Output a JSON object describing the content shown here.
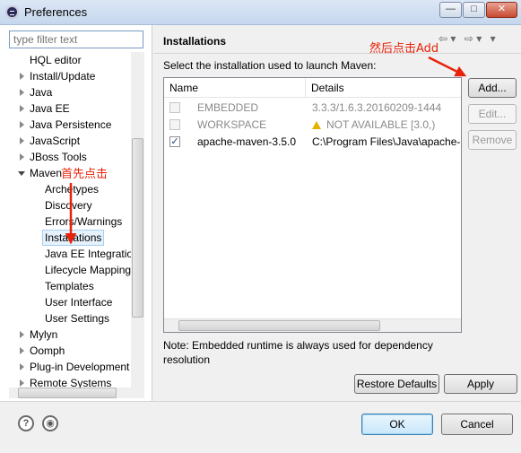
{
  "window": {
    "title": "Preferences",
    "controls": {
      "minimize": "—",
      "maximize": "□",
      "close": "✕"
    }
  },
  "sidebar": {
    "filter_placeholder": "type filter text",
    "items": [
      {
        "label": "HQL editor",
        "indent": 0,
        "toggle": "none"
      },
      {
        "label": "Install/Update",
        "indent": 0,
        "toggle": "collapsed"
      },
      {
        "label": "Java",
        "indent": 0,
        "toggle": "collapsed"
      },
      {
        "label": "Java EE",
        "indent": 0,
        "toggle": "collapsed"
      },
      {
        "label": "Java Persistence",
        "indent": 0,
        "toggle": "collapsed"
      },
      {
        "label": "JavaScript",
        "indent": 0,
        "toggle": "collapsed"
      },
      {
        "label": "JBoss Tools",
        "indent": 0,
        "toggle": "collapsed"
      },
      {
        "label": "Maven",
        "indent": 0,
        "toggle": "expanded"
      },
      {
        "label": "Archetypes",
        "indent": 1,
        "toggle": "none"
      },
      {
        "label": "Discovery",
        "indent": 1,
        "toggle": "none"
      },
      {
        "label": "Errors/Warnings",
        "indent": 1,
        "toggle": "none"
      },
      {
        "label": "Installations",
        "indent": 1,
        "toggle": "none",
        "selected": true
      },
      {
        "label": "Java EE Integration",
        "indent": 1,
        "toggle": "none"
      },
      {
        "label": "Lifecycle Mappings",
        "indent": 1,
        "toggle": "none"
      },
      {
        "label": "Templates",
        "indent": 1,
        "toggle": "none"
      },
      {
        "label": "User Interface",
        "indent": 1,
        "toggle": "none"
      },
      {
        "label": "User Settings",
        "indent": 1,
        "toggle": "none"
      },
      {
        "label": "Mylyn",
        "indent": 0,
        "toggle": "collapsed"
      },
      {
        "label": "Oomph",
        "indent": 0,
        "toggle": "collapsed"
      },
      {
        "label": "Plug-in Development",
        "indent": 0,
        "toggle": "collapsed"
      },
      {
        "label": "Remote Systems",
        "indent": 0,
        "toggle": "collapsed"
      }
    ]
  },
  "page": {
    "title": "Installations",
    "instruction": "Select the installation used to launch Maven:",
    "table": {
      "columns": [
        "Name",
        "Details"
      ],
      "rows": [
        {
          "checked": false,
          "disabled": true,
          "name": "EMBEDDED",
          "details": "3.3.3/1.6.3.20160209-1444",
          "warning": false
        },
        {
          "checked": false,
          "disabled": true,
          "name": "WORKSPACE",
          "details": "NOT AVAILABLE [3.0,)",
          "warning": true
        },
        {
          "checked": true,
          "disabled": false,
          "name": "apache-maven-3.5.0",
          "details": "C:\\Program Files\\Java\\apache-m",
          "warning": false
        }
      ]
    },
    "buttons": {
      "add": "Add...",
      "edit": "Edit...",
      "remove": "Remove",
      "restore_defaults": "Restore Defaults",
      "apply": "Apply"
    },
    "note": "Note: Embedded runtime is always used for dependency resolution"
  },
  "footer": {
    "ok": "OK",
    "cancel": "Cancel",
    "help_icon": "?",
    "import_icon": "◉"
  },
  "annotations": {
    "first_click": "首先点击",
    "then_click_add": "然后点击Add",
    "color": "#e8220a"
  }
}
